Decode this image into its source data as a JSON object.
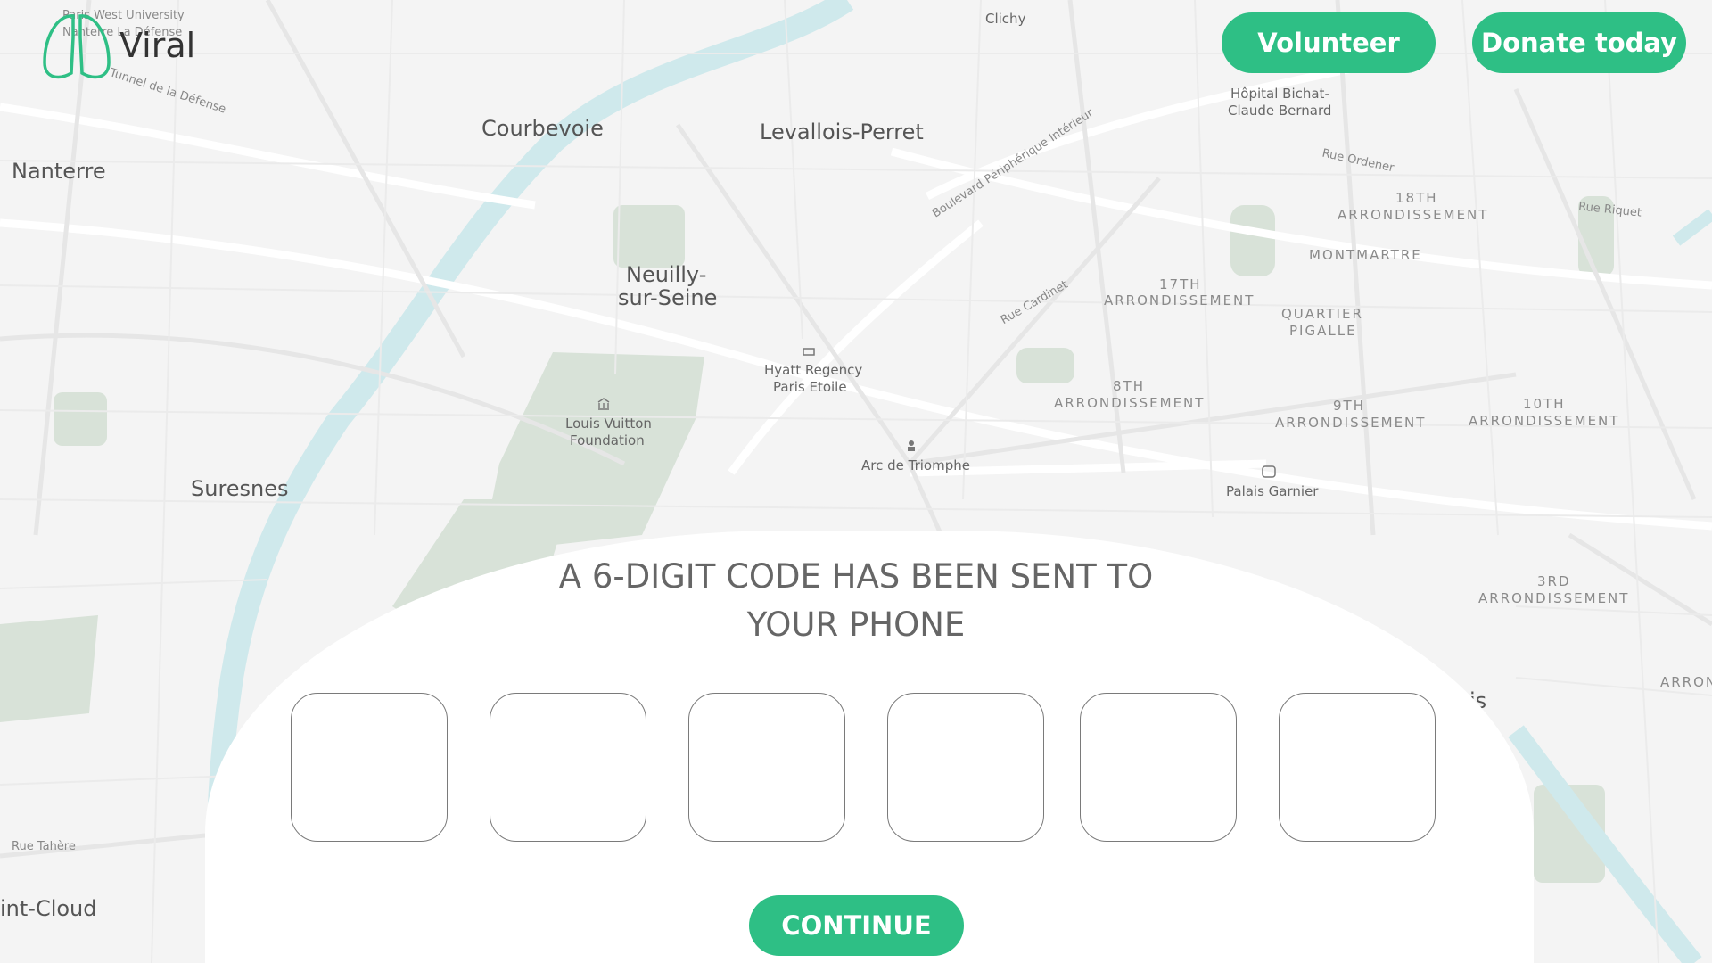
{
  "app": {
    "logo_text": "Viral"
  },
  "header": {
    "volunteer_label": "Volunteer",
    "donate_label": "Donate today"
  },
  "verification": {
    "heading_line1": "A 6-DIGIT CODE HAS BEEN SENT TO",
    "heading_line2": "YOUR PHONE",
    "digits": [
      "",
      "",
      "",
      "",
      "",
      ""
    ],
    "continue_label": "CONTINUE"
  },
  "map": {
    "cities": [
      "Courbevoie",
      "Levallois-Perret",
      "Nanterre",
      "Neuilly-",
      "sur-Seine",
      "Suresnes",
      "int-Cloud"
    ],
    "pois": [
      "Hyatt Regency",
      "Paris Etoile",
      "Louis Vuitton",
      "Foundation",
      "Arc de Triomphe",
      "Palais Garnier",
      "Hôpital Bichat-",
      "Claude Bernard",
      "Clichy"
    ],
    "districts": [
      "18TH",
      "ARRONDISSEMENT",
      "MONTMARTRE",
      "17TH",
      "ARRONDISSEMENT",
      "QUARTIER",
      "PIGALLE",
      "8TH",
      "ARRONDISSEMENT",
      "9TH",
      "ARRONDISSEMENT",
      "10TH",
      "ARRONDISSEMENT",
      "3RD",
      "ARRONDISSEMENT",
      "ARRON"
    ],
    "streets": [
      "Rue Ordener",
      "Rue Riquet",
      "Rue Cardinet",
      "Boulevard Périphérique Intérieur",
      "Rue Tahère",
      "Paris West University",
      "Nanterre La Défense",
      "Tunnel de la Défense",
      "is"
    ]
  },
  "colors": {
    "accent": "#2ebf85",
    "river": "#cfe9ec",
    "park": "#d8e2d8"
  }
}
